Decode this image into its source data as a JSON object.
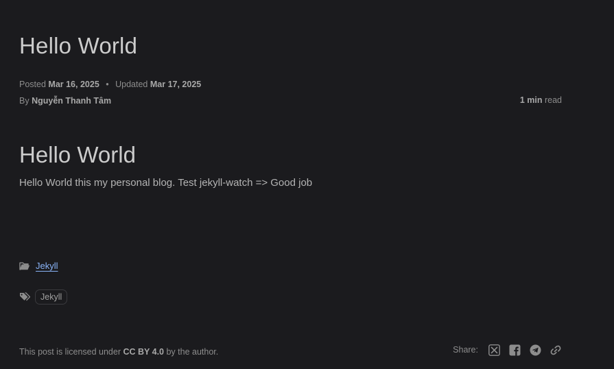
{
  "post": {
    "title": "Hello World",
    "posted_label": "Posted",
    "posted_date": "Mar 16, 2025",
    "separator": "•",
    "updated_label": "Updated",
    "updated_date": "Mar 17, 2025",
    "by_label": "By",
    "author": "Nguyễn Thanh Tâm",
    "read_minutes": "1 min",
    "read_label": "read"
  },
  "content": {
    "heading": "Hello World",
    "text": "Hello World this my personal blog. Test jekyll-watch => Good job"
  },
  "categories": {
    "icon": "folder-open-icon",
    "items": [
      "Jekyll"
    ]
  },
  "tags": {
    "icon": "tags-icon",
    "items": [
      "Jekyll"
    ]
  },
  "license": {
    "prefix": "This post is licensed under",
    "name": "CC BY 4.0",
    "suffix": "by the author."
  },
  "share": {
    "label": "Share:",
    "icons": [
      "x-twitter-icon",
      "facebook-icon",
      "telegram-icon",
      "link-icon"
    ]
  },
  "colors": {
    "background": "#1b1b1e",
    "link": "#8ab4f8",
    "text": "#b0b0b0",
    "heading": "#cccccc"
  }
}
